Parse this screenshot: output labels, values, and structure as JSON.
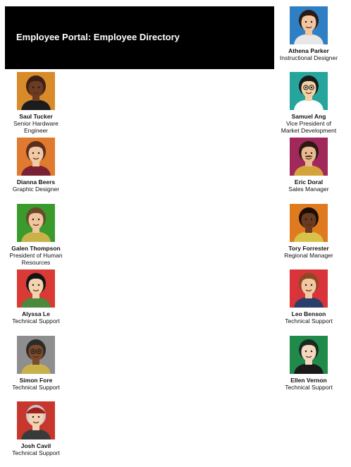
{
  "header": {
    "title": "Employee Portal: Employee Directory"
  },
  "employees": [
    {
      "name": "Athena Parker",
      "title": "Instructional Designer",
      "icon": "person-woman-dark-hair-icon",
      "bg": "#2f7fc4",
      "skin": "#f1c4a2",
      "hair": "#2b1b14",
      "shirt": "#e7e7e7"
    },
    {
      "name": "Saul Tucker",
      "title": "Senior Hardware Engineer",
      "icon": "person-man-bald-icon",
      "bg": "#d98a2b",
      "skin": "#6b3b22",
      "hair": "#3a2014",
      "shirt": "#1c1c1c"
    },
    {
      "name": "Samuel Ang",
      "title": "Vice President of Market Development",
      "icon": "person-man-glasses-icon",
      "bg": "#25a59c",
      "skin": "#f2d0a4",
      "hair": "#1a1a1a",
      "shirt": "#ffffff"
    },
    {
      "name": "Dianna Beers",
      "title": "Graphic Designer",
      "icon": "person-woman-brown-hair-icon",
      "bg": "#e07a2e",
      "skin": "#f2c9a6",
      "hair": "#5a2f1e",
      "shirt": "#7a2233"
    },
    {
      "name": "Eric Doral",
      "title": "Sales Manager",
      "icon": "person-man-mustache-icon",
      "bg": "#a0285a",
      "skin": "#e9b98f",
      "hair": "#2a1a12",
      "shirt": "#d4a33a"
    },
    {
      "name": "Galen Thompson",
      "title": "President of Human Resources",
      "icon": "person-man-smiling-icon",
      "bg": "#3a9a2c",
      "skin": "#f0c59e",
      "hair": "#6a4a2a",
      "shirt": "#c9b24a"
    },
    {
      "name": "Tory Forrester",
      "title": "Regional Manager",
      "icon": "person-woman-curly-hair-icon",
      "bg": "#e07a1e",
      "skin": "#6a3b20",
      "hair": "#1a0e08",
      "shirt": "#d8c24a"
    },
    {
      "name": "Alyssa Le",
      "title": "Technical Support",
      "icon": "person-woman-black-hair-icon",
      "bg": "#d93a35",
      "skin": "#f2d3b0",
      "hair": "#141414",
      "shirt": "#4a8a3a"
    },
    {
      "name": "Leo Benson",
      "title": "Technical Support",
      "icon": "person-man-suit-icon",
      "bg": "#d8343a",
      "skin": "#f2c7a2",
      "hair": "#8a4a22",
      "shirt": "#2c3e6a"
    },
    {
      "name": "Simon Fore",
      "title": "Technical Support",
      "icon": "person-man-beanie-icon",
      "bg": "#8e8e8e",
      "skin": "#7a4a2a",
      "hair": "#2a2a2a",
      "shirt": "#c8b04a"
    },
    {
      "name": "Ellen Vernon",
      "title": "Technical Support",
      "icon": "person-woman-short-hair-icon",
      "bg": "#1f8a4a",
      "skin": "#f4d8c0",
      "hair": "#1a2a1f",
      "shirt": "#1a1a1a"
    },
    {
      "name": "Josh Cavil",
      "title": "Technical Support",
      "icon": "person-man-cap-icon",
      "bg": "#c8372e",
      "skin": "#f3d1b2",
      "hair": "#c9c9c9",
      "shirt": "#3a3a3a"
    }
  ]
}
